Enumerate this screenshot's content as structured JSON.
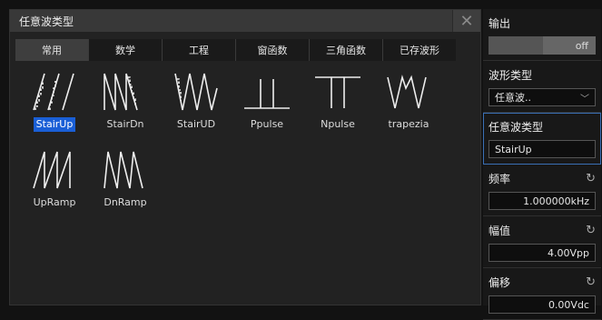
{
  "dialog": {
    "title": "任意波类型",
    "close_glyph": "✕",
    "tabs": [
      "常用",
      "数学",
      "工程",
      "窗函数",
      "三角函数",
      "已存波形"
    ],
    "active_tab": 0,
    "waveforms": [
      {
        "label": "StairUp",
        "icon": "stair-up-icon",
        "selected": true
      },
      {
        "label": "StairDn",
        "icon": "stair-down-icon"
      },
      {
        "label": "StairUD",
        "icon": "stair-up-down-icon"
      },
      {
        "label": "Ppulse",
        "icon": "positive-pulse-icon"
      },
      {
        "label": "Npulse",
        "icon": "negative-pulse-icon"
      },
      {
        "label": "trapezia",
        "icon": "trapezoid-icon"
      },
      {
        "label": "UpRamp",
        "icon": "up-ramp-icon"
      },
      {
        "label": "DnRamp",
        "icon": "down-ramp-icon"
      }
    ]
  },
  "panel": {
    "output_label": "输出",
    "output_state": "off",
    "wave_type_label": "波形类型",
    "wave_type_value": "任意波..",
    "arb_type_label": "任意波类型",
    "arb_type_value": "StairUp",
    "freq_label": "频率",
    "freq_value": "1.000000kHz",
    "amp_label": "幅值",
    "amp_value": "4.00Vpp",
    "offset_label": "偏移",
    "offset_value": "0.00Vdc",
    "refresh_glyph": "↻",
    "chevron_glyph": "﹀"
  },
  "colors": {
    "selection": "#1a5fd6",
    "background": "#121212"
  }
}
